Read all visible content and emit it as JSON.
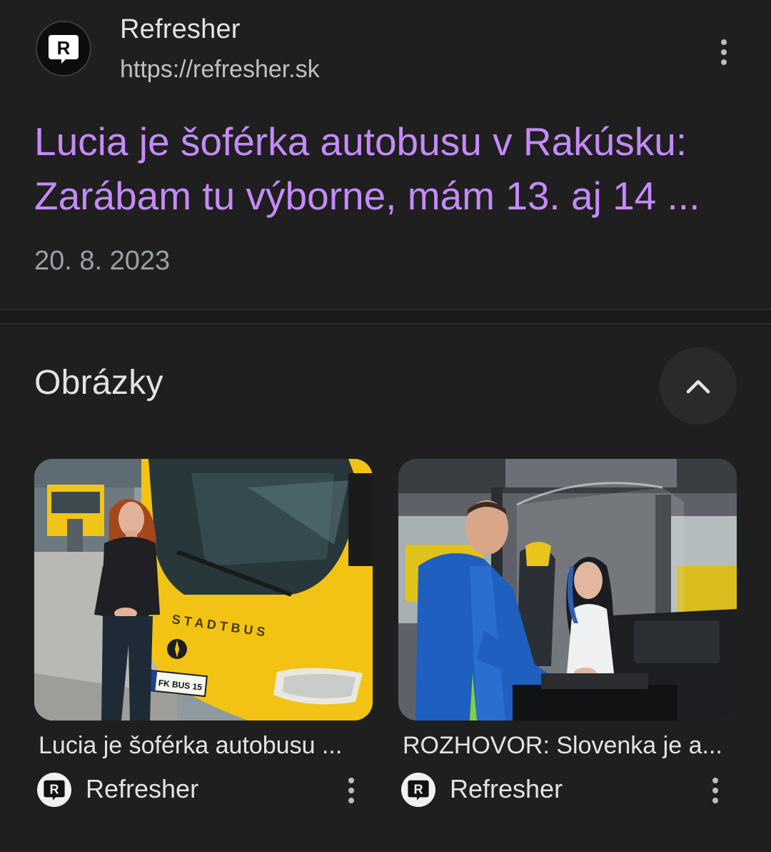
{
  "result": {
    "site_name": "Refresher",
    "site_url": "https://refresher.sk",
    "title_line1": "Lucia je šoférka autobusu v Rakúsku:",
    "title_line2": "Zarábam tu výborne, mám 13. aj 14 ...",
    "date": "20. 8. 2023",
    "favicon": "refresher-logo-icon",
    "more_icon": "more-vertical-icon"
  },
  "images_section": {
    "heading": "Obrázky",
    "collapse_icon": "chevron-up-icon",
    "cards": [
      {
        "title": "Lucia je šoférka autobusu ...",
        "source": "Refresher",
        "bus_text": "S T A D T B U S",
        "plate_text": "FK BUS 15"
      },
      {
        "title": "ROZHOVOR: Slovenka je a...",
        "source": "Refresher"
      }
    ]
  },
  "colors": {
    "background": "#1f1f1f",
    "visited_link": "#c58af9",
    "secondary_text": "#9aa0a6",
    "primary_text": "#e3e3e3"
  }
}
